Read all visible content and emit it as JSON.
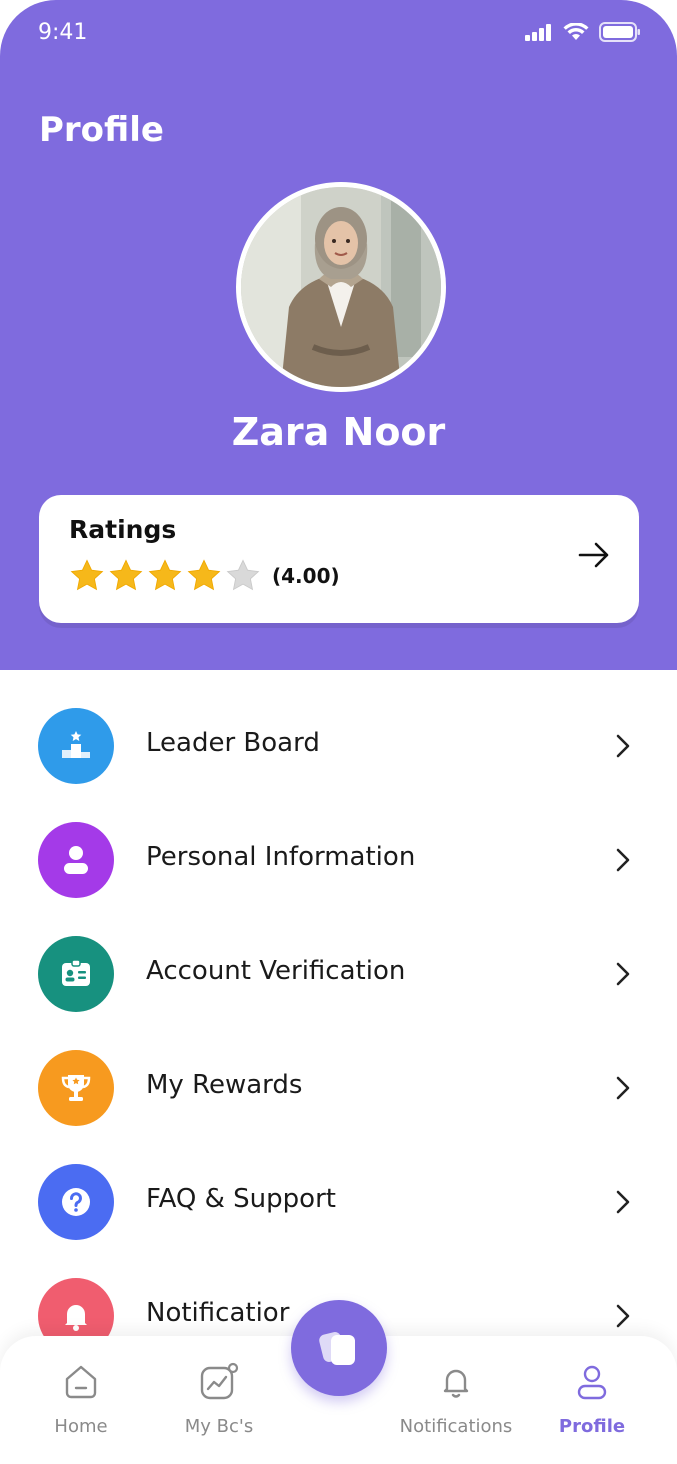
{
  "status_bar": {
    "time": "9:41"
  },
  "header": {
    "title": "Profile",
    "user_name": "Zara Noor"
  },
  "ratings": {
    "label": "Ratings",
    "value_text": "(4.00)",
    "stars_filled": 4,
    "stars_total": 5,
    "star_color": "#f6b81a"
  },
  "menu": {
    "items": [
      {
        "label": "Leader Board",
        "icon": "podium-icon",
        "color": "#2f9bea"
      },
      {
        "label": "Personal Information",
        "icon": "user-icon",
        "color": "#a43ae8"
      },
      {
        "label": "Account Verification",
        "icon": "id-card-icon",
        "color": "#17917f"
      },
      {
        "label": "My Rewards",
        "icon": "trophy-icon",
        "color": "#f79a1f"
      },
      {
        "label": "FAQ & Support",
        "icon": "question-icon",
        "color": "#4b6cf2"
      },
      {
        "label": "Notificatior",
        "icon": "bell-icon",
        "color": "#f05d6f"
      }
    ]
  },
  "bottom_nav": {
    "items": [
      {
        "label": "Home",
        "icon": "home-icon",
        "active": false
      },
      {
        "label": "My Bc's",
        "icon": "chart-icon",
        "active": false
      },
      {
        "label": "Notifications",
        "icon": "bell-outline-icon",
        "active": false
      },
      {
        "label": "Profile",
        "icon": "profile-icon",
        "active": true
      }
    ]
  },
  "colors": {
    "brand": "#7f6bde"
  }
}
